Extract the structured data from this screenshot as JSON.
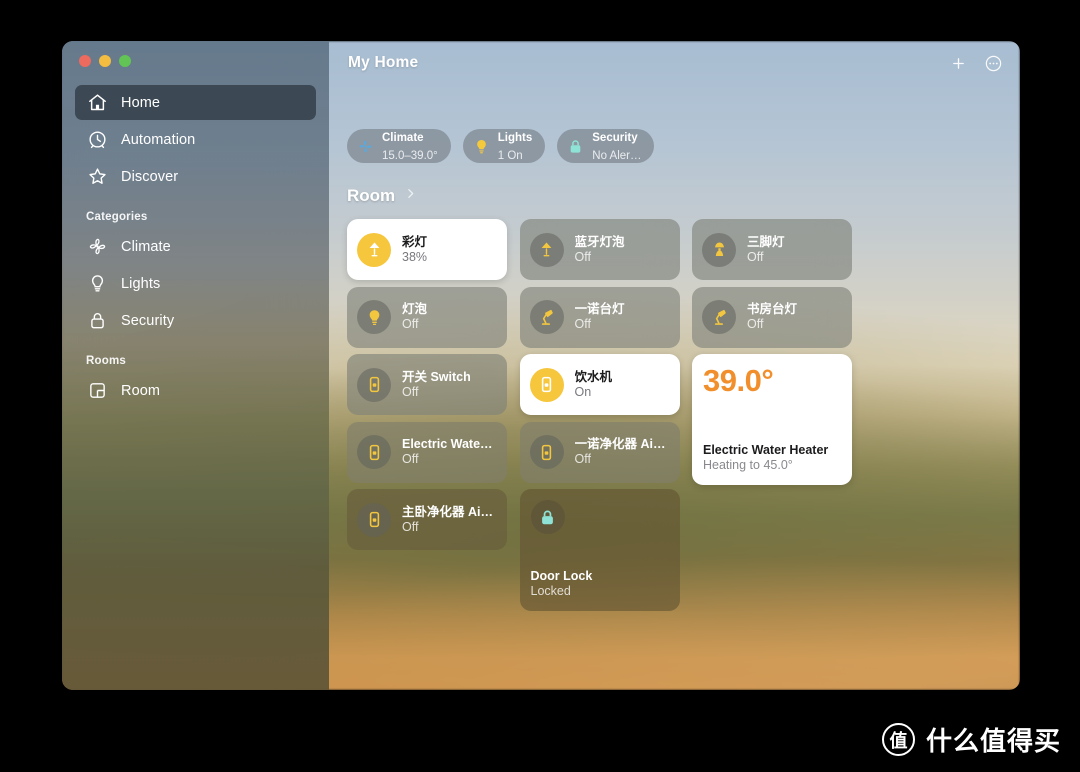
{
  "window": {
    "traffic_lights": [
      {
        "name": "close",
        "color": "#ec6a5e"
      },
      {
        "name": "minimize",
        "color": "#f2bd40"
      },
      {
        "name": "maximize",
        "color": "#61c455"
      }
    ]
  },
  "sidebar": {
    "primary": [
      {
        "label": "Home",
        "icon": "house-icon",
        "selected": true
      },
      {
        "label": "Automation",
        "icon": "clock-icon",
        "selected": false
      },
      {
        "label": "Discover",
        "icon": "star-icon",
        "selected": false
      }
    ],
    "categories_header": "Categories",
    "categories": [
      {
        "label": "Climate",
        "icon": "fan-icon"
      },
      {
        "label": "Lights",
        "icon": "bulb-icon"
      },
      {
        "label": "Security",
        "icon": "lock-icon"
      }
    ],
    "rooms_header": "Rooms",
    "rooms": [
      {
        "label": "Room",
        "icon": "room-icon"
      }
    ]
  },
  "header": {
    "title": "My Home",
    "add_label": "+",
    "more_label": "···"
  },
  "status_chips": [
    {
      "name": "Climate",
      "detail": "15.0–39.0°",
      "icon": "fan-icon",
      "color": "#5aa9dd"
    },
    {
      "name": "Lights",
      "detail": "1 On",
      "icon": "bulb-icon",
      "color": "#f5c93c"
    },
    {
      "name": "Security",
      "detail": "No Aler…",
      "icon": "lock-icon",
      "color": "#8fe3d6"
    }
  ],
  "room_section": {
    "title": "Room",
    "chevron": "chevron-right-icon"
  },
  "tiles": [
    {
      "name": "彩灯",
      "state": "38%",
      "icon": "floor-lamp-icon",
      "style": "on",
      "size": "sm",
      "col": 0,
      "row": 0
    },
    {
      "name": "蓝牙灯泡",
      "state": "Off",
      "icon": "floor-lamp-icon",
      "style": "off",
      "size": "sm",
      "col": 1,
      "row": 0
    },
    {
      "name": "三脚灯",
      "state": "Off",
      "icon": "table-lamp-icon",
      "style": "off",
      "size": "sm",
      "col": 2,
      "row": 0
    },
    {
      "name": "灯泡",
      "state": "Off",
      "icon": "bulb-icon",
      "style": "off",
      "size": "sm",
      "col": 0,
      "row": 1
    },
    {
      "name": "一诺台灯",
      "state": "Off",
      "icon": "desk-lamp-icon",
      "style": "off",
      "size": "sm",
      "col": 1,
      "row": 1
    },
    {
      "name": "书房台灯",
      "state": "Off",
      "icon": "desk-lamp-icon",
      "style": "off",
      "size": "sm",
      "col": 2,
      "row": 1
    },
    {
      "name": "开关 Switch",
      "state": "Off",
      "icon": "switch-icon",
      "style": "off",
      "size": "sm",
      "col": 0,
      "row": 2
    },
    {
      "name": "饮水机",
      "state": "On",
      "icon": "switch-icon",
      "style": "on",
      "size": "sm",
      "col": 1,
      "row": 2
    },
    {
      "name": "Electric Water…",
      "state": "Off",
      "icon": "switch-icon",
      "style": "off2",
      "size": "sm",
      "col": 0,
      "row": 3
    },
    {
      "name": "一诺净化器 Air…",
      "state": "Off",
      "icon": "switch-icon",
      "style": "off2",
      "size": "sm",
      "col": 1,
      "row": 3
    },
    {
      "name": "主卧净化器 Air…",
      "state": "Off",
      "icon": "switch-icon",
      "style": "dim",
      "size": "sm",
      "col": 0,
      "row": 4
    }
  ],
  "heater_tile": {
    "temperature": "39.0°",
    "name": "Electric Water Heater",
    "status": "Heating to 45.0°",
    "accent": "#f18f2c"
  },
  "lock_tile": {
    "name": "Door Lock",
    "status": "Locked",
    "icon": "lock-icon",
    "accent": "#8fe3d6"
  },
  "watermark": {
    "logo_char": "值",
    "text": "什么值得买"
  }
}
